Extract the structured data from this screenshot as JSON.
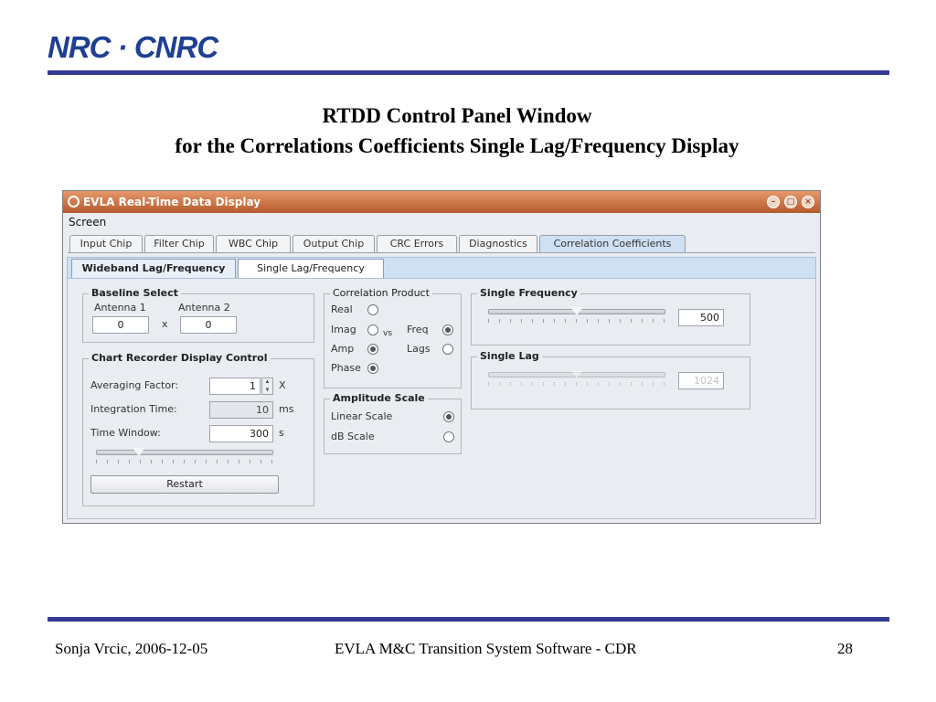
{
  "logo": {
    "text": "NRC · CNRC"
  },
  "slide": {
    "title_line1": "RTDD Control Panel Window",
    "title_line2": "for the Correlations Coefficients Single Lag/Frequency Display"
  },
  "window": {
    "title": "EVLA Real-Time Data Display",
    "menu": {
      "screen": "Screen"
    },
    "tabs": [
      {
        "label": "Input Chip"
      },
      {
        "label": "Filter Chip"
      },
      {
        "label": "WBC Chip"
      },
      {
        "label": "Output Chip"
      },
      {
        "label": "CRC Errors"
      },
      {
        "label": "Diagnostics"
      },
      {
        "label": "Correlation Coefficients"
      }
    ],
    "subtabs": [
      {
        "label": "Wideband Lag/Frequency"
      },
      {
        "label": "Single Lag/Frequency"
      }
    ],
    "baseline": {
      "legend": "Baseline Select",
      "antenna1_label": "Antenna 1",
      "antenna2_label": "Antenna 2",
      "antenna1_value": "0",
      "antenna2_value": "0",
      "x_label": "x"
    },
    "recorder": {
      "legend": "Chart Recorder Display Control",
      "averaging_label": "Averaging Factor:",
      "averaging_value": "1",
      "averaging_unit": "X",
      "integration_label": "Integration Time:",
      "integration_value": "10",
      "integration_unit": "ms",
      "window_label": "Time Window:",
      "window_value": "300",
      "window_unit": "s",
      "restart_label": "Restart"
    },
    "correlation": {
      "legend": "Correlation Product",
      "real": "Real",
      "imag": "Imag",
      "amp": "Amp",
      "phase": "Phase",
      "vs": "vs",
      "freq": "Freq",
      "lags": "Lags"
    },
    "amplitude": {
      "legend": "Amplitude Scale",
      "linear": "Linear Scale",
      "db": "dB Scale"
    },
    "single_freq": {
      "legend": "Single Frequency",
      "value": "500"
    },
    "single_lag": {
      "legend": "Single Lag",
      "value": "1024"
    }
  },
  "footer": {
    "author_date": "Sonja Vrcic, 2006-12-05",
    "event": "EVLA M&C Transition System Software - CDR",
    "page": "28"
  }
}
